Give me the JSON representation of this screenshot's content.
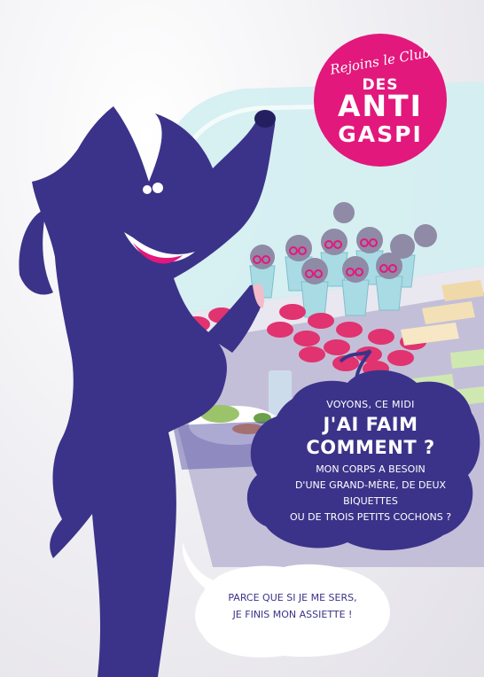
{
  "club_badge": {
    "script_text": "Rejoins le Club",
    "line_des": "DES",
    "line_anti": "ANTI",
    "line_gaspi": "GASPI",
    "color": "#e2187c"
  },
  "speech_bubble_main": {
    "line1": "VOYONS, CE MIDI",
    "line2": "J'AI FAIM COMMENT ?",
    "line3": "MON CORPS A BESOIN",
    "line4": "D'UNE GRAND-MÈRE, DE DEUX BIQUETTES",
    "line5": "OU DE TROIS PETITS COCHONS ?",
    "color": "#3b3389"
  },
  "speech_bubble_secondary": {
    "line1": "PARCE QUE SI JE ME SERS,",
    "line2": "JE FINIS MON ASSIETTE !"
  },
  "colors": {
    "wolf": "#3b3389",
    "pink": "#e2187c",
    "display_case": "#cfecef"
  }
}
